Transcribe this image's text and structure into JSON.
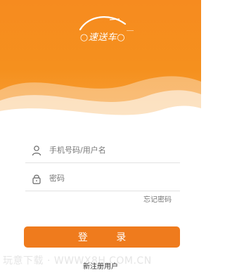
{
  "brand": {
    "logo_text": "○速送车○"
  },
  "login_form": {
    "phone_placeholder": "手机号码/用户名",
    "password_placeholder": "密码",
    "forgot_password": "忘记密码",
    "login_button": "登 录",
    "register_link": "新注册用户"
  },
  "watermark": "玩意下载 · WWWX8H.COM.CN",
  "colors": {
    "primary": "#f68b1f",
    "button": "#ef7b1d",
    "placeholder": "#777777"
  },
  "icons": {
    "phone_field": "user-icon",
    "password_field": "lock-icon"
  }
}
